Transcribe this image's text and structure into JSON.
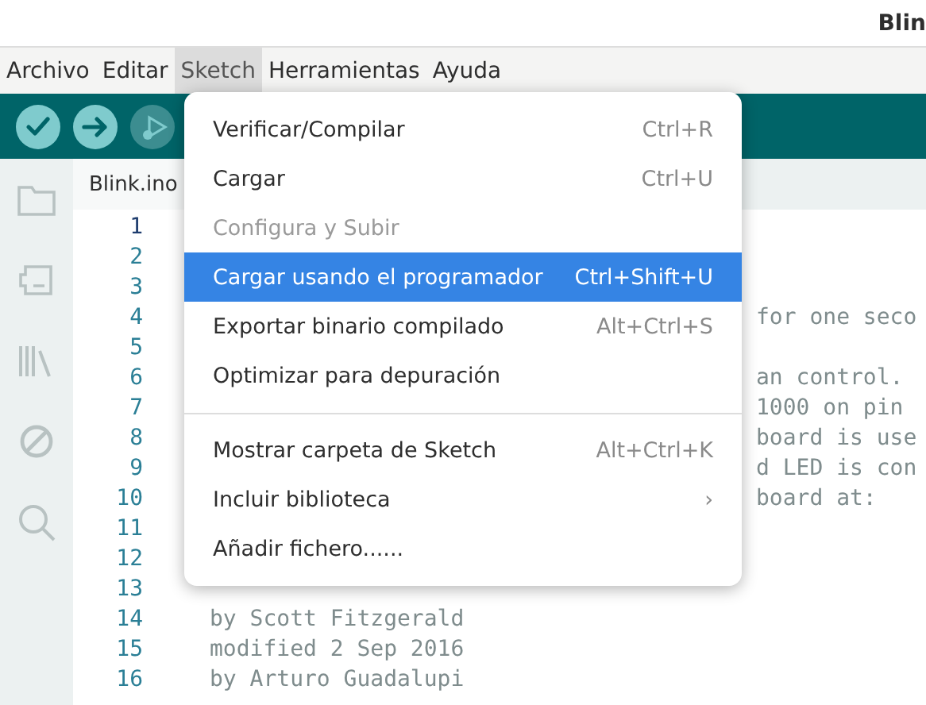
{
  "window": {
    "title": "Blin"
  },
  "menubar": [
    {
      "label": "Archivo",
      "selected": false
    },
    {
      "label": "Editar",
      "selected": false
    },
    {
      "label": "Sketch",
      "selected": true
    },
    {
      "label": "Herramientas",
      "selected": false
    },
    {
      "label": "Ayuda",
      "selected": false
    }
  ],
  "toolbar": [
    {
      "kind": "verify",
      "disabled": false
    },
    {
      "kind": "upload",
      "disabled": false
    },
    {
      "kind": "debug",
      "disabled": true
    }
  ],
  "sidebar": [
    {
      "kind": "folder"
    },
    {
      "kind": "board"
    },
    {
      "kind": "library"
    },
    {
      "kind": "debug"
    },
    {
      "kind": "search"
    }
  ],
  "tab": {
    "label": "Blink.ino"
  },
  "editor": {
    "lines": [
      {
        "number": "1",
        "current": true
      },
      {
        "number": "2",
        "current": false
      },
      {
        "number": "3",
        "current": false
      },
      {
        "number": "4",
        "current": false,
        "kind": "tail",
        "text": "for one seco"
      },
      {
        "number": "5",
        "current": false
      },
      {
        "number": "6",
        "current": false,
        "kind": "tail",
        "text": "an control."
      },
      {
        "number": "7",
        "current": false,
        "kind": "tail",
        "text": "1000 on pin"
      },
      {
        "number": "8",
        "current": false,
        "kind": "tail",
        "text": "board is use"
      },
      {
        "number": "9",
        "current": false,
        "kind": "tail",
        "text": "d LED is con"
      },
      {
        "number": "10",
        "current": false,
        "kind": "tail",
        "text": "board at:"
      },
      {
        "number": "11",
        "current": false
      },
      {
        "number": "12",
        "current": false
      },
      {
        "number": "13",
        "current": false
      },
      {
        "number": "14",
        "current": false,
        "kind": "full",
        "text": "by Scott Fitzgerald"
      },
      {
        "number": "15",
        "current": false,
        "kind": "full",
        "text": "modified 2 Sep 2016"
      },
      {
        "number": "16",
        "current": false,
        "kind": "full",
        "text": "by Arturo Guadalupi"
      }
    ]
  },
  "menu": {
    "items": [
      {
        "kind": "item",
        "label": "Verificar/Compilar",
        "shortcut": "Ctrl+R",
        "disabled": false,
        "selected": false
      },
      {
        "kind": "item",
        "label": "Cargar",
        "shortcut": "Ctrl+U",
        "disabled": false,
        "selected": false
      },
      {
        "kind": "item",
        "label": "Configura y Subir",
        "disabled": true,
        "selected": false
      },
      {
        "kind": "item",
        "label": "Cargar usando el programador",
        "shortcut": "Ctrl+Shift+U",
        "disabled": false,
        "selected": true
      },
      {
        "kind": "item",
        "label": "Exportar binario compilado",
        "shortcut": "Alt+Ctrl+S",
        "disabled": false,
        "selected": false
      },
      {
        "kind": "item",
        "label": "Optimizar para depuración",
        "disabled": false,
        "selected": false
      },
      {
        "kind": "separator"
      },
      {
        "kind": "item",
        "label": "Mostrar carpeta de Sketch",
        "shortcut": "Alt+Ctrl+K",
        "disabled": false,
        "selected": false
      },
      {
        "kind": "submenu",
        "label": "Incluir biblioteca",
        "arrow": "›",
        "disabled": false,
        "selected": false
      },
      {
        "kind": "item",
        "label": "Añadir fichero......",
        "disabled": false,
        "selected": false
      }
    ]
  }
}
